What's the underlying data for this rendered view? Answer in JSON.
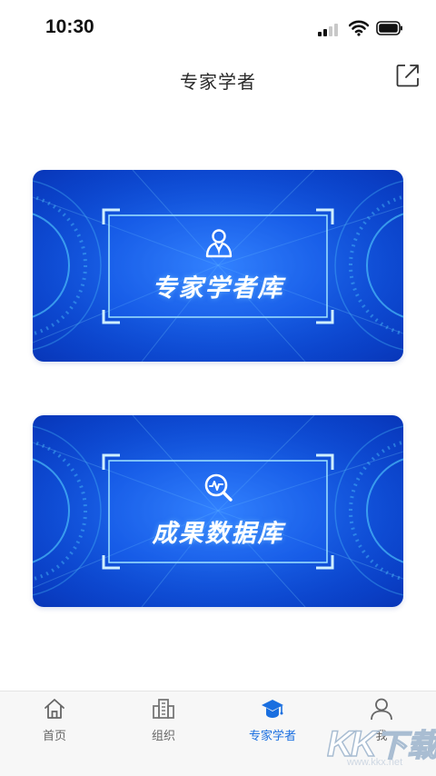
{
  "status_bar": {
    "time": "10:30",
    "signal_bars_on": 2,
    "signal_bars_total": 4
  },
  "header": {
    "title": "专家学者",
    "share_icon": "share-icon"
  },
  "cards": [
    {
      "label": "专家学者库",
      "icon": "person-icon"
    },
    {
      "label": "成果数据库",
      "icon": "search-chart-icon"
    }
  ],
  "tab_bar": {
    "active_index": 2,
    "active_color": "#1a6fe0",
    "items": [
      {
        "label": "首页",
        "icon": "home-icon"
      },
      {
        "label": "组织",
        "icon": "building-icon"
      },
      {
        "label": "专家学者",
        "icon": "graduation-cap-icon"
      },
      {
        "label": "我",
        "icon": "user-icon"
      }
    ]
  },
  "watermark": {
    "text": "KK下载",
    "url": "www.kkx.net"
  },
  "colors": {
    "card_blue": "#0f56e6",
    "card_glow": "#4fd2ff"
  }
}
